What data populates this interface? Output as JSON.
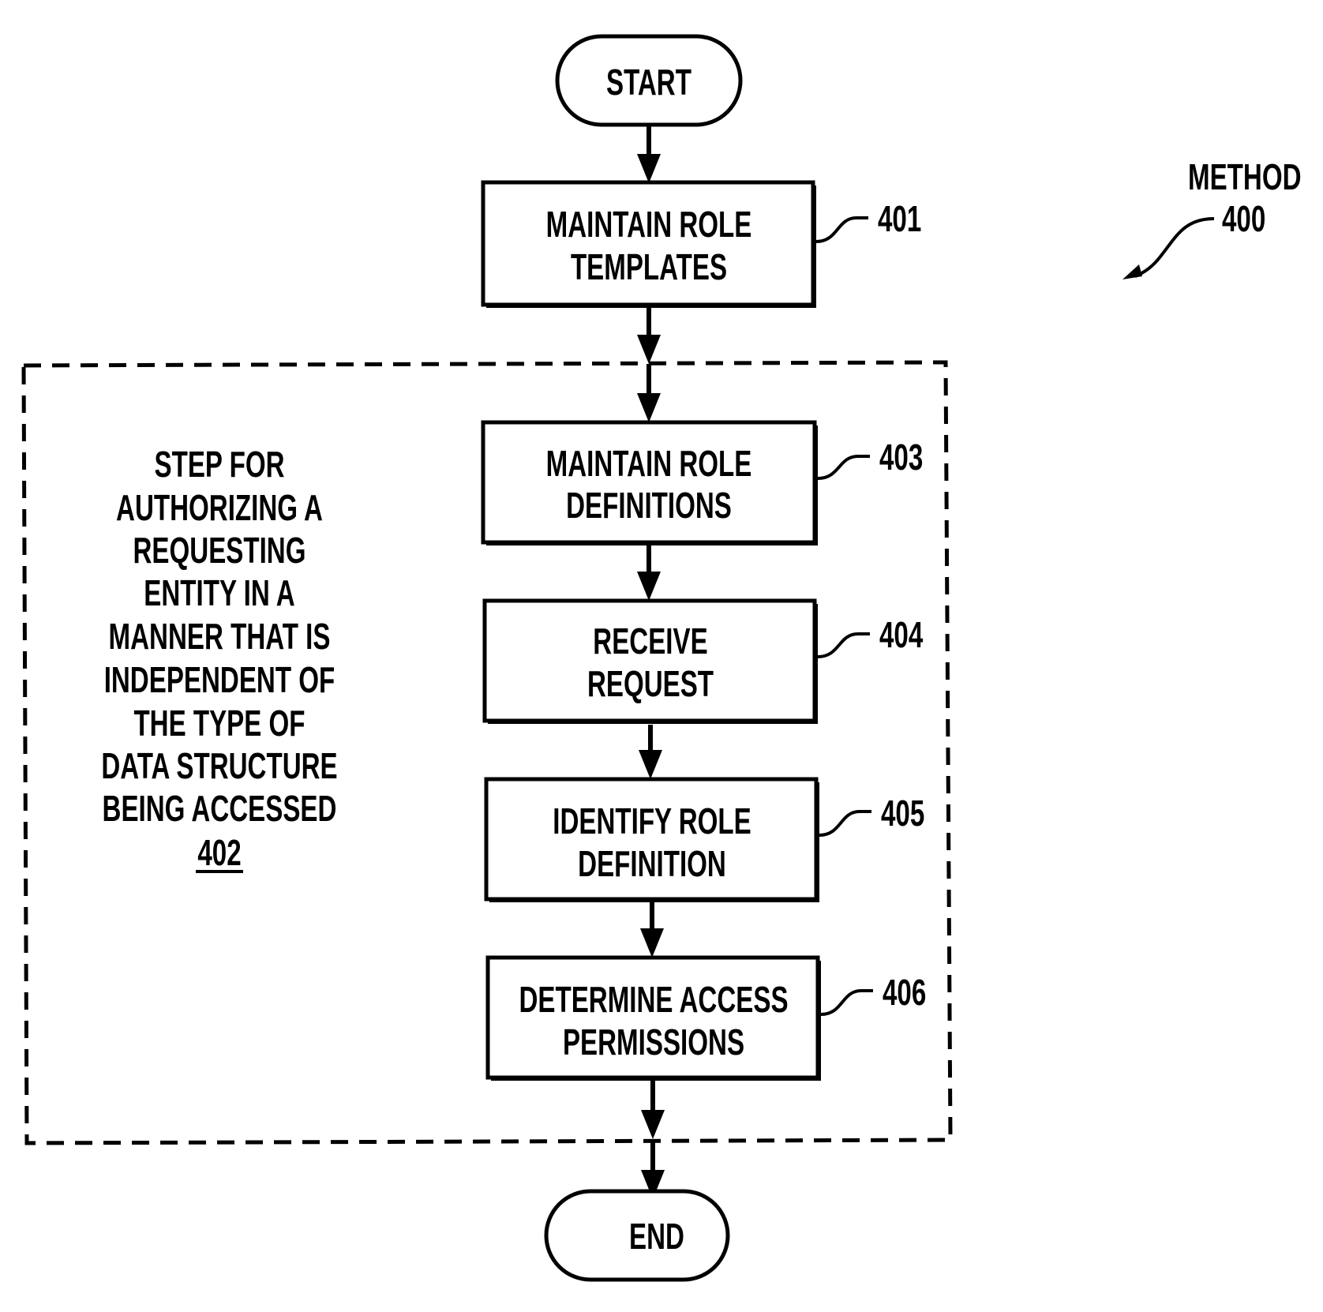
{
  "figure": {
    "method_label": "METHOD",
    "method_number": "400",
    "colors": {
      "ink": "#000000",
      "paper": "#ffffff"
    }
  },
  "terminals": {
    "start": "START",
    "end": "END"
  },
  "steps": [
    {
      "id": "401",
      "lines": [
        "MAINTAIN ROLE",
        "TEMPLATES"
      ]
    },
    {
      "id": "403",
      "lines": [
        "MAINTAIN ROLE",
        "DEFINITIONS"
      ]
    },
    {
      "id": "404",
      "lines": [
        "RECEIVE",
        "REQUEST"
      ]
    },
    {
      "id": "405",
      "lines": [
        "IDENTIFY ROLE",
        "DEFINITION"
      ]
    },
    {
      "id": "406",
      "lines": [
        "DETERMINE ACCESS",
        "PERMISSIONS"
      ]
    }
  ],
  "step_group": {
    "lines": [
      "STEP FOR",
      "AUTHORIZING A",
      "REQUESTING",
      "ENTITY IN A",
      "MANNER THAT IS",
      "INDEPENDENT OF",
      "THE TYPE OF",
      "DATA STRUCTURE",
      "BEING ACCESSED"
    ],
    "number": "402"
  }
}
